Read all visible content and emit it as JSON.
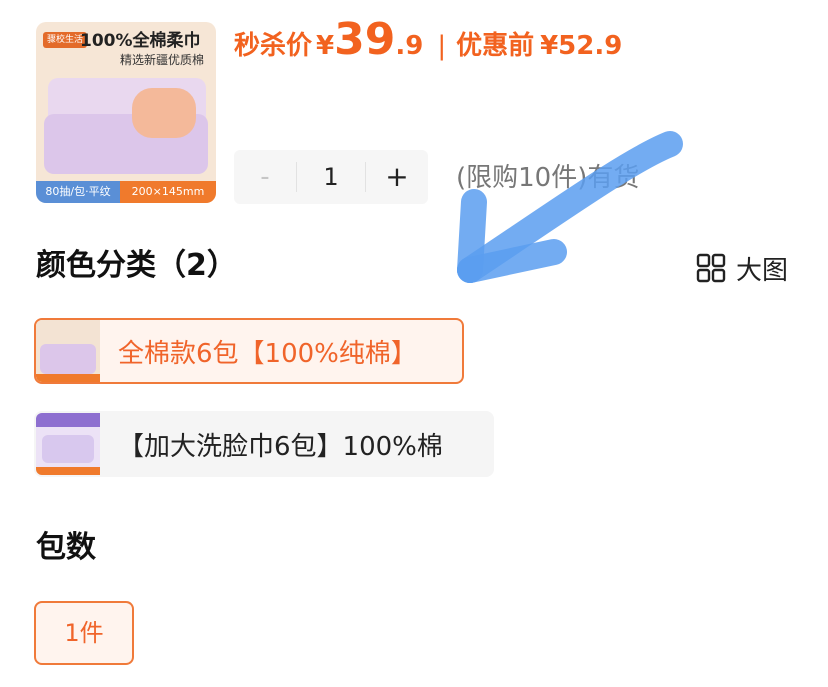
{
  "product": {
    "thumbnail": {
      "brand_text": "骤校生活",
      "headline": "100%全棉柔巾",
      "subline": "精选新疆优质棉",
      "spec_left": "80抽/包·平纹",
      "spec_right": "200×145mm"
    },
    "price": {
      "label": "秒杀价",
      "currency": "¥",
      "integer": "39",
      "decimal": ".9",
      "original_label": "优惠前",
      "original_price": "¥52.9",
      "color": "#f2621f"
    }
  },
  "quantity": {
    "minus": "-",
    "value": "1",
    "plus": "+",
    "limit_note": "(限购10件)有货"
  },
  "color_section": {
    "title": "颜色分类（2）",
    "big_view_label": "大图",
    "big_view_icon": "grid-icon",
    "options": [
      {
        "label": "全棉款6包【100%纯棉】",
        "selected": true
      },
      {
        "label": "【加大洗脸巾6包】100%棉",
        "selected": false
      }
    ]
  },
  "count_section": {
    "title": "包数",
    "options": [
      {
        "label": "1件",
        "selected": true
      }
    ]
  },
  "colors": {
    "accent": "#f07a3a",
    "selected_bg": "#fff4ee",
    "annotation_arrow": "#5b9df0"
  }
}
